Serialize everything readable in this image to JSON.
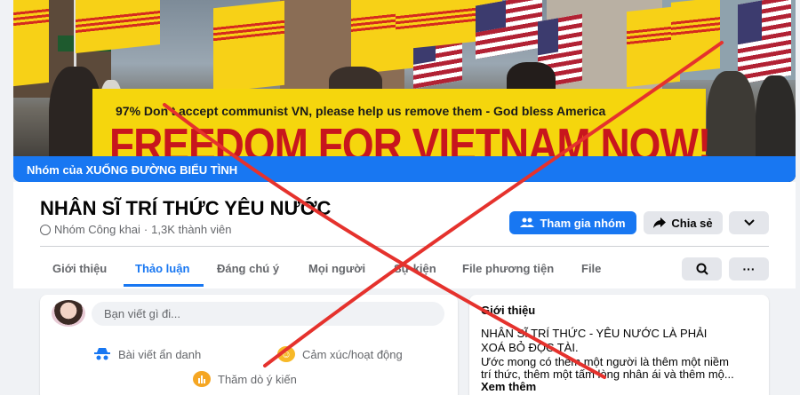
{
  "cover": {
    "banner_line1": "97% Don't accept communist VN, please help us remove them - God bless America",
    "banner_line2": "FREEDOM FOR VIETNAM NOW!",
    "caption": "Nhóm của XUỐNG ĐƯỜNG BIỂU TÌNH"
  },
  "group": {
    "name": "NHÂN SĨ TRÍ THỨC YÊU NƯỚC",
    "privacy": "Nhóm Công khai",
    "separator": "·",
    "members": "1,3K thành viên"
  },
  "actions": {
    "join_label": "Tham gia nhóm",
    "share_label": "Chia sẻ",
    "more_label": "⌄"
  },
  "tabs": [
    {
      "label": "Giới thiệu"
    },
    {
      "label": "Thảo luận"
    },
    {
      "label": "Đáng chú ý"
    },
    {
      "label": "Mọi người"
    },
    {
      "label": "Sự kiện"
    },
    {
      "label": "File phương tiện"
    },
    {
      "label": "File"
    }
  ],
  "tab_search_icon": "search-icon",
  "tab_more_label": "···",
  "composer": {
    "placeholder": "Bạn viết gì đi...",
    "anon_post": "Bài viết ẩn danh",
    "feeling": "Cảm xúc/hoạt động",
    "poll": "Thăm dò ý kiến"
  },
  "about": {
    "title": "Giới thiệu",
    "line1": "NHÂN SĨ TRÍ THỨC - YÊU NƯỚC LÀ PHẢI",
    "line2": "XOÁ BỎ ĐỘC TÀI.",
    "line3": "Ước mong có thêm một người là thêm một niềm",
    "line4": "trí thức, thêm một tấm lòng nhân ái và thêm mộ...",
    "see_more": "Xem thêm"
  },
  "colors": {
    "accent": "#1877f2",
    "overlay_x": "#e5322d"
  }
}
